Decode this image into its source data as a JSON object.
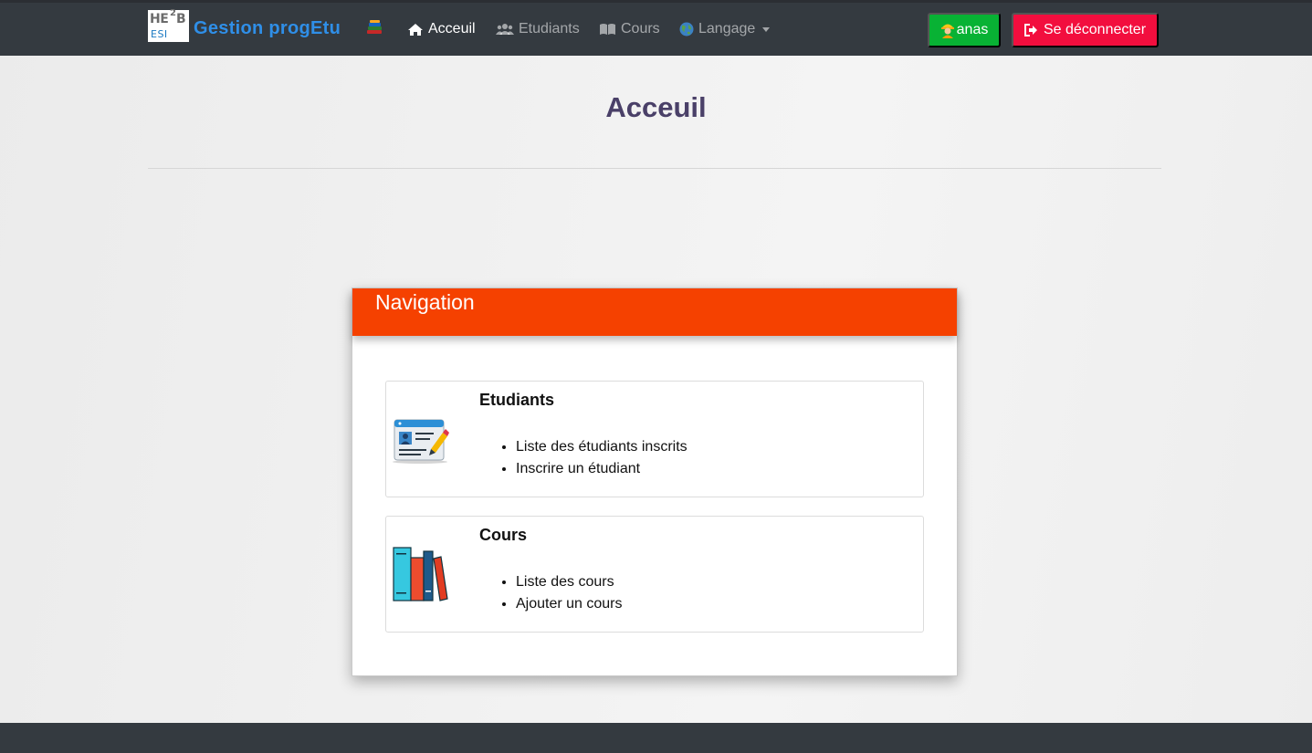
{
  "navbar": {
    "logo": {
      "line1": "HE",
      "sup": "2",
      "line1b": "B",
      "line2": "ESI"
    },
    "brand": "Gestion progEtu",
    "brand_emoji": "books-icon",
    "items": [
      {
        "label": "Acceuil",
        "icon": "home-icon",
        "active": true
      },
      {
        "label": "Etudiants",
        "icon": "users-icon",
        "active": false
      },
      {
        "label": "Cours",
        "icon": "book-open-icon",
        "active": false
      },
      {
        "label": "Langage",
        "icon": "globe-icon",
        "active": false
      }
    ],
    "user_label": "anas",
    "logout_label": "Se déconnecter",
    "colors": {
      "background": "#343a40",
      "brand": "#2f8fe8",
      "user_button": "#08b234",
      "logout_button": "#f20e3e"
    }
  },
  "page": {
    "title": "Acceuil"
  },
  "card": {
    "title": "Navigation",
    "header_color": "#f54100",
    "sections": [
      {
        "title": "Etudiants",
        "icon": "student-card-icon",
        "links": [
          "Liste des étudiants inscrits",
          "Inscrire un étudiant"
        ]
      },
      {
        "title": "Cours",
        "icon": "books-icon",
        "links": [
          "Liste des cours",
          "Ajouter un cours"
        ]
      }
    ]
  }
}
